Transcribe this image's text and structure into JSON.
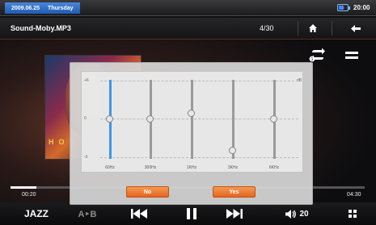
{
  "status": {
    "date": "2009.06.25",
    "weekday": "Thursday",
    "time": "20:00",
    "battery_level": 0.6,
    "accent_color": "#2a6fd0"
  },
  "title_bar": {
    "song": "Sound-Moby.MP3",
    "track_count": "4/30",
    "home_icon": "home-icon",
    "back_icon": "back-arrow-icon"
  },
  "album": {
    "band_text": "HOE"
  },
  "side_icons": {
    "repeat": "repeat-once-icon",
    "menu": "menu-icon"
  },
  "equalizer": {
    "scale": {
      "top": "+6",
      "mid": "0",
      "bottom": "-6",
      "db": "dB"
    },
    "bands": [
      {
        "label": "60Hz",
        "level": 0.0,
        "active": true
      },
      {
        "label": "300Hz",
        "level": 0.0,
        "active": false
      },
      {
        "label": "1KHz",
        "level": 0.15,
        "active": false
      },
      {
        "label": "3KHz",
        "level": -0.8,
        "active": false
      },
      {
        "label": "6KHz",
        "level": 0.0,
        "active": false
      }
    ],
    "no_label": "No",
    "yes_label": "Yes",
    "button_color": "#e8742e"
  },
  "progress": {
    "elapsed": "00:20",
    "total": "04:30",
    "fraction": 0.074
  },
  "controls": {
    "eq_preset": "JAZZ",
    "ab_repeat": "A‣B",
    "volume": "20",
    "icons": [
      "previous-icon",
      "pause-icon",
      "next-icon",
      "volume-icon",
      "grid-icon"
    ]
  }
}
